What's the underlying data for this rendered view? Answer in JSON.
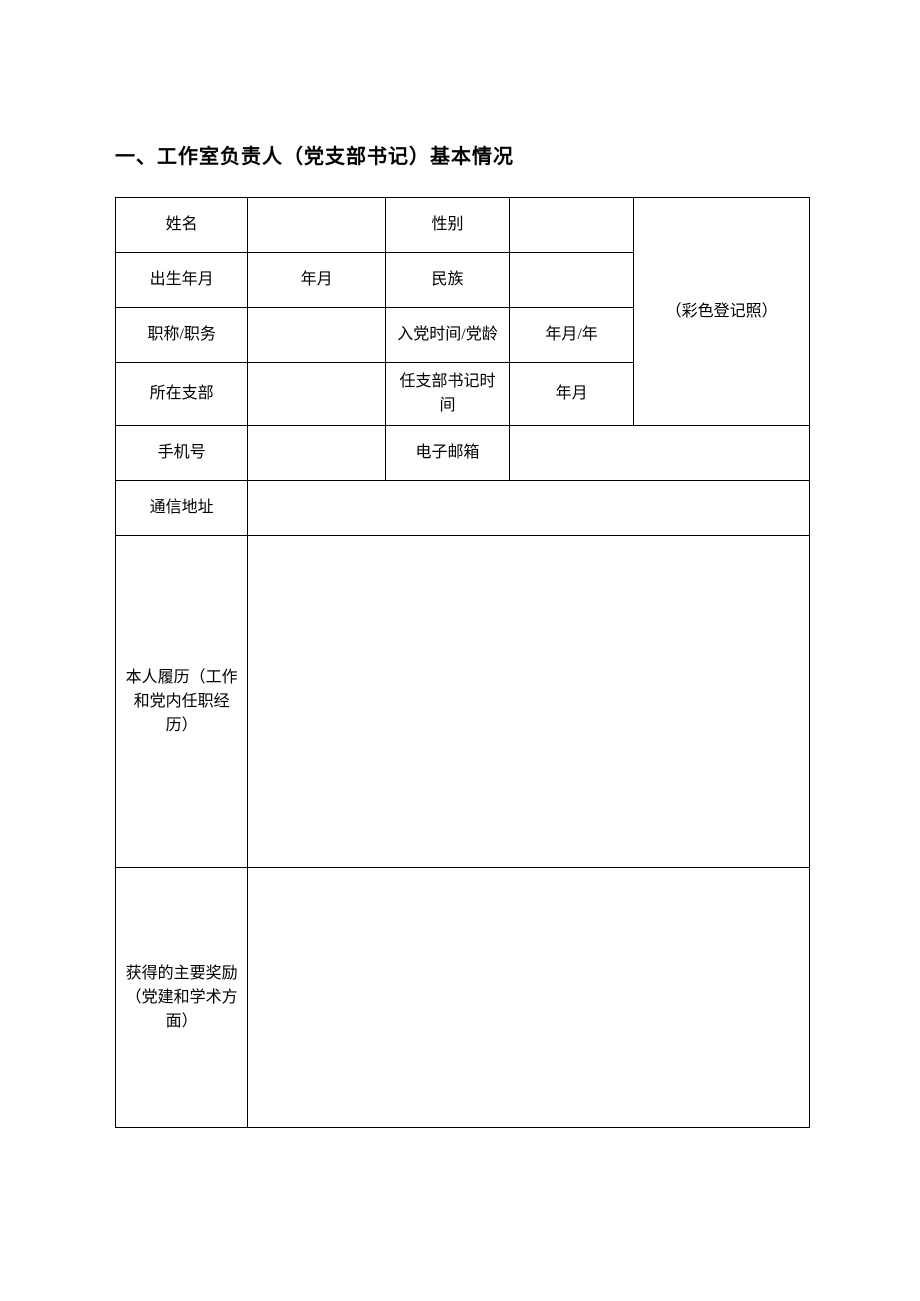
{
  "title": "一、工作室负责人（党支部书记）基本情况",
  "labels": {
    "name": "姓名",
    "gender": "性别",
    "dob": "出生年月",
    "ethnicity": "民族",
    "title_position": "职称/职务",
    "join_party": "入党时间/党龄",
    "branch": "所在支部",
    "secretary_time": "任支部书记时间",
    "phone": "手机号",
    "email": "电子邮箱",
    "address": "通信地址",
    "resume": "本人履历（工作和党内任职经历）",
    "awards": "获得的主要奖励（党建和学术方面）",
    "photo": "（彩色登记照）"
  },
  "values": {
    "name": "",
    "gender": "",
    "dob": "年月",
    "ethnicity": "",
    "title_position": "",
    "join_party": "年月/年",
    "branch": "",
    "secretary_time": "年月",
    "phone": "",
    "email": "",
    "address": "",
    "resume": "",
    "awards": ""
  }
}
